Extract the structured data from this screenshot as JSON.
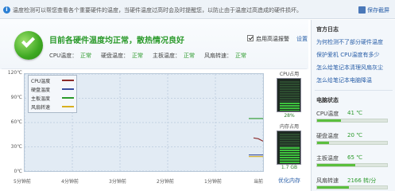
{
  "info_bar": {
    "icon": "info-icon",
    "text": "温度检测可以帮您查看各个重要硬件的温度，当硬件温度过高时会及时提醒您，以防止由于温度过高造成的硬件损坏。",
    "save_label": "保存截屏",
    "save_icon": "save-icon"
  },
  "status": {
    "message": "目前各硬件温度均正常，散热情况良好",
    "icon": "check-shield-icon",
    "alarm_label": "启用高温报警",
    "alarm_checked": true,
    "settings_label": "设置",
    "readouts": [
      {
        "label": "CPU温度：",
        "value": "正常"
      },
      {
        "label": "硬盘温度：",
        "value": "正常"
      },
      {
        "label": "主板温度：",
        "value": "正常"
      },
      {
        "label": "风扇转速：",
        "value": "正常"
      }
    ]
  },
  "chart_data": {
    "type": "line",
    "y_ticks": [
      "120℃",
      "90℃",
      "60℃",
      "30℃",
      "0℃"
    ],
    "ylim": [
      0,
      120
    ],
    "x_ticks": [
      "5分钟前",
      "4分钟前",
      "3分钟前",
      "2分钟前",
      "1分钟前",
      "当前"
    ],
    "grid": true,
    "legend_position": "top-left",
    "series": [
      {
        "name": "CPU温度",
        "color": "#8b2a2a",
        "x": [
          -0.2,
          -0.1,
          0
        ],
        "values": [
          41,
          40,
          37
        ]
      },
      {
        "name": "硬盘温度",
        "color": "#3a4fa0",
        "x": [
          -0.3,
          0
        ],
        "values": [
          20,
          20
        ]
      },
      {
        "name": "主板温度",
        "color": "#2a9a2a",
        "x": [
          -0.3,
          0
        ],
        "values": [
          65,
          65
        ]
      },
      {
        "name": "风扇转速",
        "color": "#d8b020",
        "x": [
          -0.3,
          0
        ],
        "values": [
          18,
          18
        ]
      }
    ]
  },
  "gauges": {
    "cpu": {
      "title": "CPU占用",
      "value": "28%",
      "fraction": 0.28
    },
    "memory": {
      "title": "内存占用",
      "value": "1.7 GB",
      "fraction": 0.55
    },
    "optimize_label": "优化内存"
  },
  "sidebar": {
    "tips_title": "官方日志",
    "tips": [
      "为何检测不了部分硬件温度",
      "保护爱机 CPU温度有多少",
      "怎么给笔记本清理风扇灰尘",
      "怎么给笔记本电脑降温"
    ],
    "stats_title": "电脑状态",
    "stats": [
      {
        "label": "CPU温度",
        "value": "41 ℃",
        "fraction": 0.34
      },
      {
        "label": "硬盘温度",
        "value": "20 ℃",
        "fraction": 0.17
      },
      {
        "label": "主板温度",
        "value": "65 ℃",
        "fraction": 0.54
      },
      {
        "label": "风扇转速",
        "value": "2166 转/分",
        "fraction": 0.45
      }
    ]
  }
}
